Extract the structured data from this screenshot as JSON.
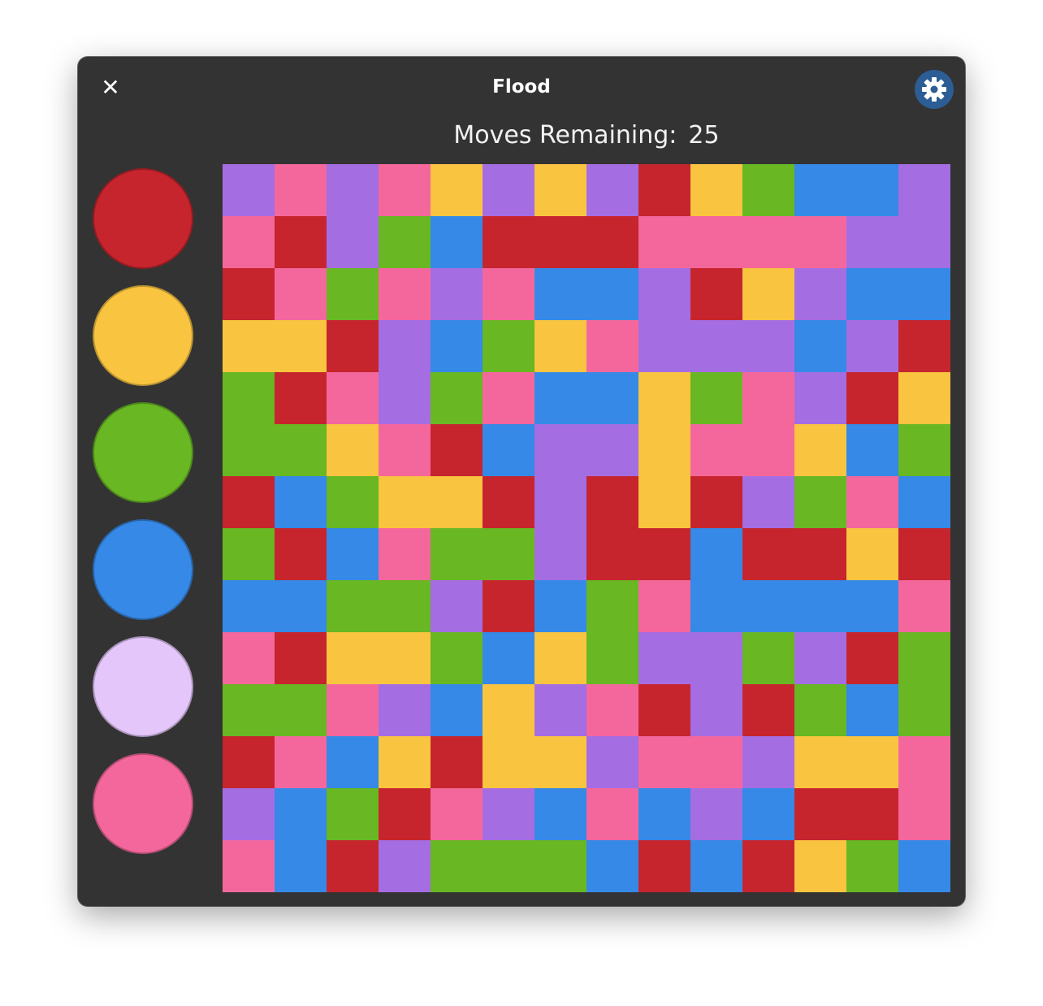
{
  "window": {
    "title": "Flood",
    "close_glyph": "✕",
    "settings_icon": "gear-icon"
  },
  "status": {
    "moves_label": "Moves Remaining:",
    "moves_value": "25"
  },
  "colors": {
    "red": "#c6252e",
    "yellow": "#f9c440",
    "green": "#68b723",
    "blue": "#3689e6",
    "lilac": "#e4c6fa",
    "pink": "#f4679d",
    "purple": "#a56de2"
  },
  "palette": [
    {
      "name": "red",
      "color": "#c6252e"
    },
    {
      "name": "yellow",
      "color": "#f9c440"
    },
    {
      "name": "green",
      "color": "#68b723"
    },
    {
      "name": "blue",
      "color": "#3689e6"
    },
    {
      "name": "lilac",
      "color": "#e4c6fa"
    },
    {
      "name": "pink",
      "color": "#f4679d"
    }
  ],
  "board": {
    "size": 14,
    "legend": {
      "R": "red",
      "Y": "yellow",
      "G": "green",
      "B": "blue",
      "K": "pink",
      "P": "purple"
    },
    "rows": [
      "PKPKYPYPRYGBBP",
      "KRPGBRRRKKKKPP",
      "RKGKPKBBPRYPBB",
      "YYRPBGYKPPPBPR",
      "GRKPGKBBYGKPRY",
      "GGYKRBPPYKKYBG",
      "RBGYYRPRYRPGKB",
      "GRBKGGPRRBRRYR",
      "BBGGPRBGKBBBBK",
      "KRYYGBYGPPGPRG",
      "GGKPBYPKRPRGBG",
      "RKBYRYYPKKPYYK",
      "PBGRKPBKBPBRRK",
      "KBRPGGGBRBRYGB"
    ]
  }
}
